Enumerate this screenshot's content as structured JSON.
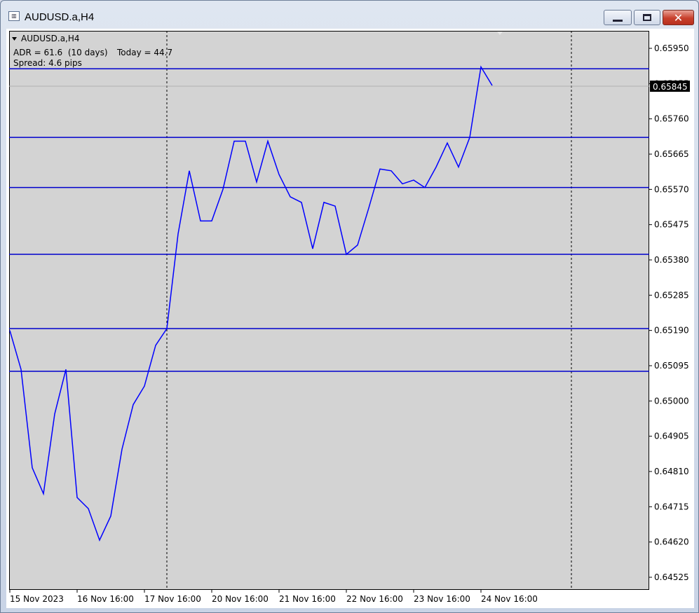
{
  "window": {
    "title": "AUDUSD.a,H4",
    "icon": "chart-window-icon",
    "buttons": {
      "minimize": "minimize-icon",
      "maximize": "maximize-icon",
      "close": "close-icon"
    },
    "close_glyph": "✕"
  },
  "chart": {
    "symbol_label": "AUDUSD.a,H4",
    "collapse_icon": "triangle-down-icon",
    "adr_text": "ADR = 61.6  (10 days)",
    "today_text": "Today = 44.7",
    "spread_text": "Spread: 4.6 pips",
    "current_price": "0.65845",
    "colors": {
      "background": "#d3d3d3",
      "line": "#0000ff",
      "hline": "#0000cd",
      "price_label_bg": "#000000"
    }
  },
  "chart_data": {
    "type": "line",
    "series": [
      {
        "values": [
          0.6519,
          0.65085,
          0.6482,
          0.6475,
          0.64965,
          0.65085,
          0.6474,
          0.6471,
          0.64625,
          0.6469,
          0.6487,
          0.6499,
          0.6504,
          0.6515,
          0.65195,
          0.6545,
          0.6562,
          0.65485,
          0.65485,
          0.6557,
          0.657,
          0.657,
          0.6559,
          0.657,
          0.6561,
          0.6555,
          0.65535,
          0.6541,
          0.65535,
          0.65525,
          0.65395,
          0.6542,
          0.6552,
          0.65625,
          0.6562,
          0.65585,
          0.65595,
          0.65575,
          0.6563,
          0.65695,
          0.6563,
          0.6571,
          0.659,
          0.6585
        ]
      }
    ],
    "horizontal_lines": [
      0.65895,
      0.6571,
      0.65575,
      0.65395,
      0.65195,
      0.6508
    ],
    "ylim": [
      0.64495,
      0.66
    ],
    "y_ticks": [
      "0.65950",
      "0.65855",
      "0.65760",
      "0.65665",
      "0.65570",
      "0.65475",
      "0.65380",
      "0.65285",
      "0.65190",
      "0.65095",
      "0.65000",
      "0.64905",
      "0.64810",
      "0.64715",
      "0.64620",
      "0.64525"
    ],
    "x_tick_labels": [
      "15 Nov 2023",
      "16 Nov 16:00",
      "17 Nov 16:00",
      "20 Nov 16:00",
      "21 Nov 16:00",
      "22 Nov 16:00",
      "23 Nov 16:00",
      "24 Nov 16:00"
    ],
    "period_separators": [
      "17 Nov 16:00",
      "24 Nov 16:00+"
    ],
    "grid": false
  }
}
